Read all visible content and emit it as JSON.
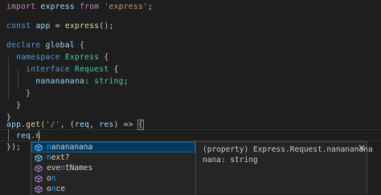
{
  "code": {
    "l1": {
      "kw": "import",
      "name": "express",
      "from": "from",
      "str": "'express'",
      "end": ";"
    },
    "l3": {
      "kw": "const",
      "name": "app",
      "eq": " = ",
      "fn": "express",
      "end": "();"
    },
    "l5": {
      "kw": "declare",
      "name": "global",
      "brace": " {"
    },
    "l6": {
      "kw": "namespace",
      "name": "Express",
      "brace": " {"
    },
    "l7": {
      "kw": "interface",
      "name": "Request",
      "brace": " {"
    },
    "l8": {
      "prop": "nanananana",
      "colon": ": ",
      "type": "string",
      "end": ";"
    },
    "l9": "}",
    "l10": "}",
    "l11": "}",
    "l13": {
      "obj": "app",
      "dot": ".",
      "fn": "get",
      "open": "(",
      "str": "'/'",
      "mid": ", (",
      "p1": "req",
      "comma": ", ",
      "p2": "res",
      "arrow": ") => ",
      "brace": "{"
    },
    "l14": {
      "obj": "req",
      "dot": ".",
      "typed": "n"
    },
    "l15": "});"
  },
  "suggest": {
    "items": [
      {
        "match": "n",
        "rest": "anananana",
        "kind": "field"
      },
      {
        "match": "n",
        "rest": "ext?",
        "kind": "field"
      },
      {
        "pre": "eve",
        "match": "n",
        "rest": "tNames",
        "kind": "method"
      },
      {
        "pre": "o",
        "match": "n",
        "rest": "",
        "kind": "method"
      },
      {
        "pre": "o",
        "match": "n",
        "rest": "ce",
        "kind": "method"
      }
    ],
    "details_line1": "(property) Express.Request.nanananana",
    "details_line2": "nana: string",
    "close_icon": "close-icon",
    "accent": "#18a3ff",
    "selected_bg": "#04395e"
  }
}
